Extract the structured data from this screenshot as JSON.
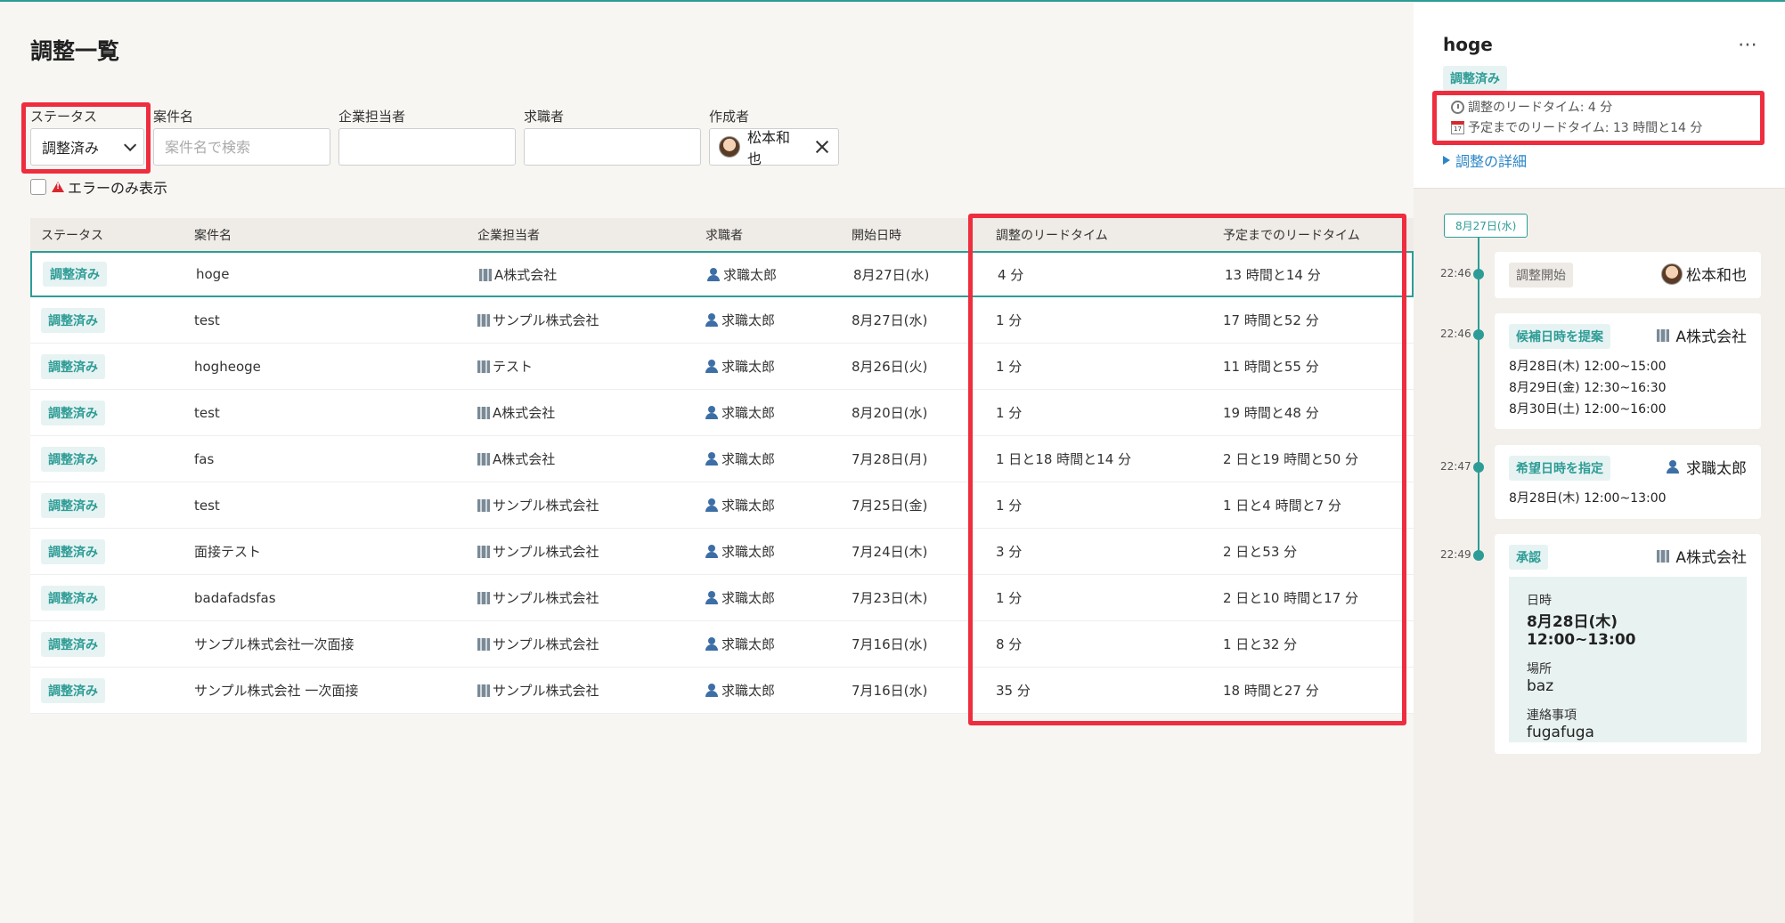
{
  "page": {
    "title": "調整一覧"
  },
  "filters": {
    "status_label": "ステータス",
    "status_value": "調整済み",
    "case_label": "案件名",
    "case_placeholder": "案件名で検索",
    "company_label": "企業担当者",
    "seeker_label": "求職者",
    "creator_label": "作成者",
    "creator_value": "松本和也",
    "error_only_label": "エラーのみ表示"
  },
  "table": {
    "headers": [
      "ステータス",
      "案件名",
      "企業担当者",
      "求職者",
      "開始日時",
      "調整のリードタイム",
      "予定までのリードタイム"
    ],
    "rows": [
      {
        "status": "調整済み",
        "case": "hoge",
        "company": "A株式会社",
        "seeker": "求職太郎",
        "start": "8月27日(水)",
        "lead": "4 分",
        "until": "13 時間と14 分"
      },
      {
        "status": "調整済み",
        "case": "test",
        "company": "サンプル株式会社",
        "seeker": "求職太郎",
        "start": "8月27日(水)",
        "lead": "1 分",
        "until": "17 時間と52 分"
      },
      {
        "status": "調整済み",
        "case": "hogheoge",
        "company": "テスト",
        "seeker": "求職太郎",
        "start": "8月26日(火)",
        "lead": "1 分",
        "until": "11 時間と55 分"
      },
      {
        "status": "調整済み",
        "case": "test",
        "company": "A株式会社",
        "seeker": "求職太郎",
        "start": "8月20日(水)",
        "lead": "1 分",
        "until": "19 時間と48 分"
      },
      {
        "status": "調整済み",
        "case": "fas",
        "company": "A株式会社",
        "seeker": "求職太郎",
        "start": "7月28日(月)",
        "lead": "1 日と18 時間と14 分",
        "until": "2 日と19 時間と50 分"
      },
      {
        "status": "調整済み",
        "case": "test",
        "company": "サンプル株式会社",
        "seeker": "求職太郎",
        "start": "7月25日(金)",
        "lead": "1 分",
        "until": "1 日と4 時間と7 分"
      },
      {
        "status": "調整済み",
        "case": "面接テスト",
        "company": "サンプル株式会社",
        "seeker": "求職太郎",
        "start": "7月24日(木)",
        "lead": "3 分",
        "until": "2 日と53 分"
      },
      {
        "status": "調整済み",
        "case": "badafadsfas",
        "company": "サンプル株式会社",
        "seeker": "求職太郎",
        "start": "7月23日(木)",
        "lead": "1 分",
        "until": "2 日と10 時間と17 分"
      },
      {
        "status": "調整済み",
        "case": "サンプル株式会社一次面接",
        "company": "サンプル株式会社",
        "seeker": "求職太郎",
        "start": "7月16日(水)",
        "lead": "8 分",
        "until": "1 日と32 分"
      },
      {
        "status": "調整済み",
        "case": "サンプル株式会社 一次面接",
        "company": "サンプル株式会社",
        "seeker": "求職太郎",
        "start": "7月16日(水)",
        "lead": "35 分",
        "until": "18 時間と27 分"
      }
    ]
  },
  "panel": {
    "title": "hoge",
    "more": "⋯",
    "status": "調整済み",
    "lead_time": "調整のリードタイム: 4 分",
    "until_time": "予定までのリードタイム: 13 時間と14 分",
    "calendar_day": "17",
    "details_link": "調整の詳細",
    "date_chip": "8月27日(水)",
    "events": [
      {
        "time": "22:46",
        "label": "調整開始",
        "actor": "松本和也",
        "lines": []
      },
      {
        "time": "22:46",
        "label": "候補日時を提案",
        "actor": "A株式会社",
        "lines": [
          "8月28日(木) 12:00~15:00",
          "8月29日(金) 12:30~16:30",
          "8月30日(土) 12:00~16:00"
        ]
      },
      {
        "time": "22:47",
        "label": "希望日時を指定",
        "actor": "求職太郎",
        "lines": [
          "8月28日(木) 12:00~13:00"
        ]
      },
      {
        "time": "22:49",
        "label": "承認",
        "actor": "A株式会社",
        "lines": []
      }
    ],
    "approval": {
      "date_label": "日時",
      "date_value": "8月28日(木) 12:00~13:00",
      "place_label": "場所",
      "place_value": "baz",
      "note_label": "連絡事項",
      "note_value": "fugafuga"
    }
  },
  "colors": {
    "accent": "#2e9c96",
    "highlight": "#ee2d3e",
    "link": "#2a86c7"
  }
}
